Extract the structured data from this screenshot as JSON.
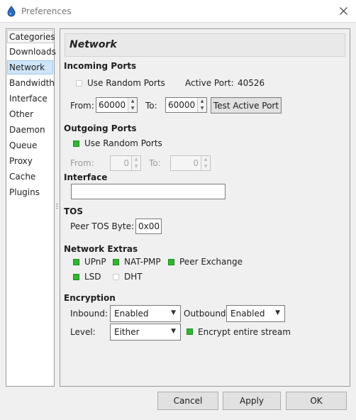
{
  "window": {
    "title": "Preferences",
    "icon": "droplet-icon",
    "close_icon": "close-icon"
  },
  "categories": {
    "header": "Categories",
    "items": [
      "Downloads",
      "Network",
      "Bandwidth",
      "Interface",
      "Other",
      "Daemon",
      "Queue",
      "Proxy",
      "Cache",
      "Plugins"
    ],
    "selected": "Network"
  },
  "page": {
    "title": "Network"
  },
  "incoming": {
    "heading": "Incoming Ports",
    "use_random_label": "Use Random Ports",
    "use_random_checked": false,
    "active_port_label": "Active Port:",
    "active_port_value": "40526",
    "from_label": "From:",
    "from_value": "60000",
    "to_label": "To:",
    "to_value": "60000",
    "test_button": "Test Active Port"
  },
  "outgoing": {
    "heading": "Outgoing Ports",
    "use_random_label": "Use Random Ports",
    "use_random_checked": true,
    "from_label": "From:",
    "from_value": "0",
    "to_label": "To:",
    "to_value": "0"
  },
  "interface": {
    "heading": "Interface",
    "value": ""
  },
  "tos": {
    "heading": "TOS",
    "peer_tos_label": "Peer TOS Byte:",
    "peer_tos_value": "0x00"
  },
  "extras": {
    "heading": "Network Extras",
    "upnp_label": "UPnP",
    "upnp_checked": true,
    "natpmp_label": "NAT-PMP",
    "natpmp_checked": true,
    "peer_exchange_label": "Peer Exchange",
    "peer_exchange_checked": true,
    "lsd_label": "LSD",
    "lsd_checked": true,
    "dht_label": "DHT",
    "dht_checked": false
  },
  "encryption": {
    "heading": "Encryption",
    "inbound_label": "Inbound:",
    "inbound_value": "Enabled",
    "outbound_label": "Outbound:",
    "outbound_value": "Enabled",
    "level_label": "Level:",
    "level_value": "Either",
    "encrypt_stream_label": "Encrypt entire stream",
    "encrypt_stream_checked": true
  },
  "footer": {
    "cancel": "Cancel",
    "apply": "Apply",
    "ok": "OK"
  },
  "colors": {
    "checked": "#2eb82e",
    "selection": "#cfe5f8"
  }
}
